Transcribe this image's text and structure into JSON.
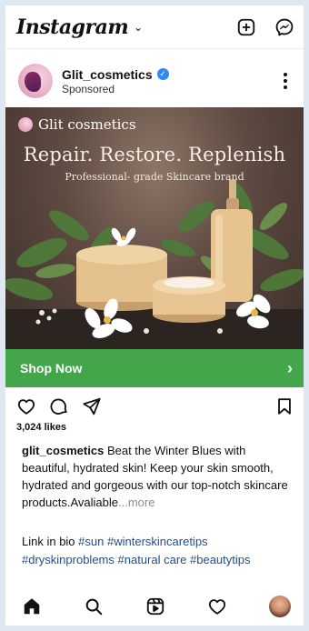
{
  "app": {
    "brand": "Instagram",
    "caret": "⌄"
  },
  "post": {
    "username": "Glit_cosmetics",
    "verified_mark": "✓",
    "sponsored": "Sponsored"
  },
  "ad": {
    "logo_text": "Glit cosmetics",
    "headline": "Repair. Restore. Replenish",
    "subheadline": "Professional- grade Skincare brand"
  },
  "cta": {
    "label": "Shop Now",
    "arrow": "›",
    "color": "#43a64a"
  },
  "engagement": {
    "likes": "3,024 likes"
  },
  "caption": {
    "user": "glit_cosmetics",
    "text": "Beat the Winter Blues with beautiful, hydrated skin! Keep your skin smooth, hydrated and gorgeous with our top-notch skincare products.Avaliable",
    "ellipsis": "...",
    "more": "more",
    "link_line": "Link in bio",
    "hashtags": [
      "#sun",
      "#winterskincaretips",
      "#dryskinproblems",
      "#natural care",
      "#beautytips"
    ]
  },
  "icons": {
    "top": [
      "add-post-icon",
      "messenger-icon"
    ],
    "post": [
      "more-icon"
    ],
    "actions": [
      "heart-icon",
      "comment-icon",
      "share-icon",
      "bookmark-icon"
    ],
    "nav": [
      "home-icon",
      "search-icon",
      "reels-icon",
      "activity-icon",
      "profile-avatar"
    ]
  }
}
